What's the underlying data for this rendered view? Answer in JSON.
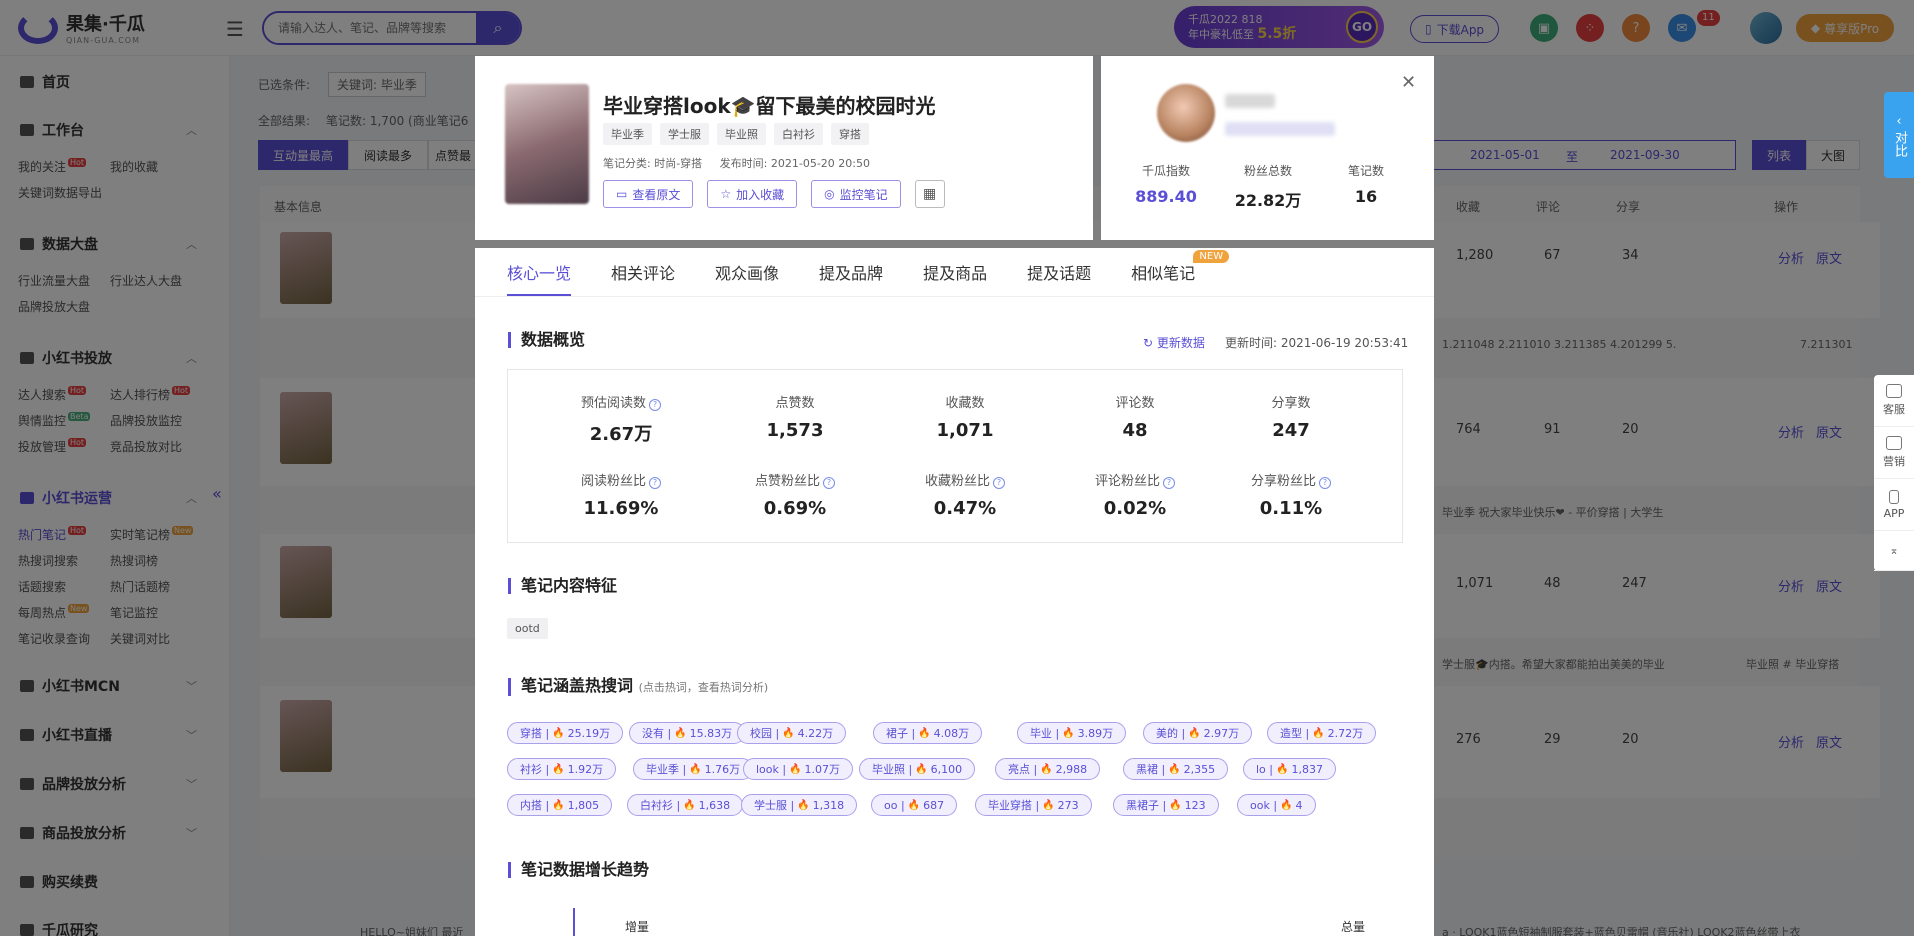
{
  "topbar": {
    "logo_text": "果集·千瓜",
    "logo_sub": "QIAN-GUA.COM",
    "search_placeholder": "请输入达人、笔记、品牌等搜索",
    "promo_line1": "千瓜2022 818",
    "promo_line2": "年中豪礼低至",
    "promo_discount": "5.5折",
    "promo_go": "GO",
    "download_app": "下载App",
    "notification_count": "11",
    "pro_label": "尊享版Pro",
    "accent": "#5a4fd6"
  },
  "sidebar": {
    "home": "首页",
    "workbench": "工作台",
    "my_follow": "我的关注",
    "my_collect": "我的收藏",
    "keyword_export": "关键词数据导出",
    "data_board": "数据大盘",
    "industry_flow": "行业流量大盘",
    "industry_kol": "行业达人大盘",
    "brand_ads": "品牌投放大盘",
    "xhs_ads": "小红书投放",
    "kol_search": "达人搜索",
    "kol_rank": "达人排行榜",
    "sentiment": "舆情监控",
    "ad_monitor": "品牌投放监控",
    "ad_manage": "投放管理",
    "ad_compare": "竞品投放对比",
    "xhs_ops": "小红书运营",
    "hot_notes": "热门笔记",
    "realtime_notes": "实时笔记榜",
    "hot_search": "热搜词搜索",
    "hot_search_rank": "热搜词榜",
    "topic_search": "话题搜索",
    "hot_topic_rank": "热门话题榜",
    "weekly_hot": "每周热点",
    "note_monitor": "笔记监控",
    "note_index": "笔记收录查询",
    "keyword_compare": "关键词对比",
    "xhs_mcn": "小红书MCN",
    "xhs_live": "小红书直播",
    "brand_analysis": "品牌投放分析",
    "product_analysis": "商品投放分析",
    "purchase": "购买续费",
    "research": "千瓜研究",
    "hot": "Hot",
    "beta": "Beta",
    "new": "New"
  },
  "background": {
    "selected_conditions": "已选条件:",
    "keyword_chip": "关键词: 毕业季",
    "total": "全部结果:",
    "notes_count": "笔记数: 1,700 (商业笔记6",
    "tab_interaction": "互动量最高",
    "tab_reads": "阅读最多",
    "tab_likes": "点赞最",
    "date_from": "2021-05-01",
    "date_to_label": "至",
    "date_to": "2021-09-30",
    "view_list": "列表",
    "view_grid": "大图",
    "col_basic": "基本信息",
    "col_collect": "收藏",
    "col_comment": "评论",
    "col_share": "分享",
    "col_action": "操作",
    "analyze": "分析",
    "original": "原文",
    "rows": [
      {
        "collect": "1,280",
        "comment": "67",
        "share": "34"
      },
      {
        "collect": "764",
        "comment": "91",
        "share": "20"
      },
      {
        "collect": "1,071",
        "comment": "48",
        "share": "247"
      },
      {
        "collect": "276",
        "comment": "29",
        "share": "20"
      }
    ],
    "strip_text_1": "1.211048 2.211010 3.211385 4.201299 5.",
    "strip_text_2": "7.211301",
    "strip_text_3": "毕业季 祝大家毕业快乐❤ - 平价穿搭 | 大学生",
    "strip_text_4": "学士服🎓内搭。希望大家都能拍出美美的毕业",
    "strip_text_5": "毕业照 # 毕业穿搭",
    "strip_text_6": "a · LOOK1蓝色短袖制服套装+蓝色贝雷帽 (音乐社) LOOK2蓝色丝带上衣",
    "strip_text_7": "HELLO~姐妹们 最近",
    "right_float": "对比",
    "tool_service": "客服",
    "tool_marketing": "营销",
    "tool_app": "APP"
  },
  "note": {
    "title": "毕业穿搭look🎓留下最美的校园时光",
    "tags": [
      "毕业季",
      "学士服",
      "毕业照",
      "白衬衫",
      "穿搭"
    ],
    "category": "笔记分类: 时尚-穿搭",
    "publish_time": "发布时间: 2021-05-20 20:50",
    "btn_view_original": "查看原文",
    "btn_collect": "加入收藏",
    "btn_monitor": "监控笔记"
  },
  "profile": {
    "stats": [
      {
        "label": "千瓜指数",
        "value": "889.40"
      },
      {
        "label": "粉丝总数",
        "value": "22.82万"
      },
      {
        "label": "笔记数",
        "value": "16"
      }
    ]
  },
  "tabs": [
    "核心一览",
    "相关评论",
    "观众画像",
    "提及品牌",
    "提及商品",
    "提及话题",
    "相似笔记"
  ],
  "tab_new_badge": "NEW",
  "overview": {
    "title": "数据概览",
    "refresh": "更新数据",
    "update_time": "更新时间: 2021-06-19 20:53:41",
    "row1": [
      {
        "label": "预估阅读数",
        "value": "2.67万"
      },
      {
        "label": "点赞数",
        "value": "1,573"
      },
      {
        "label": "收藏数",
        "value": "1,071"
      },
      {
        "label": "评论数",
        "value": "48"
      },
      {
        "label": "分享数",
        "value": "247"
      }
    ],
    "row2": [
      {
        "label": "阅读粉丝比",
        "value": "11.69%"
      },
      {
        "label": "点赞粉丝比",
        "value": "0.69%"
      },
      {
        "label": "收藏粉丝比",
        "value": "0.47%"
      },
      {
        "label": "评论粉丝比",
        "value": "0.02%"
      },
      {
        "label": "分享粉丝比",
        "value": "0.11%"
      }
    ]
  },
  "features": {
    "title": "笔记内容特征",
    "tag": "ootd"
  },
  "keywords": {
    "title": "笔记涵盖热搜词",
    "hint": "(点击热词，查看热词分析)",
    "items": [
      "穿搭 | 25.19万",
      "没有 | 15.83万",
      "校园 | 4.22万",
      "裙子 | 4.08万",
      "毕业 | 3.89万",
      "美的 | 2.97万",
      "造型 | 2.72万",
      "衬衫 | 1.92万",
      "毕业季 | 1.76万",
      "look | 1.07万",
      "毕业照 | 6,100",
      "亮点 | 2,988",
      "黑裙 | 2,355",
      "lo | 1,837",
      "内搭 | 1,805",
      "白衬衫 | 1,638",
      "学士服 | 1,318",
      "oo | 687",
      "毕业穿搭 | 273",
      "黑裙子 | 123",
      "ook | 4"
    ]
  },
  "growth": {
    "title": "笔记数据增长趋势",
    "increment": "增量",
    "total": "总量"
  }
}
